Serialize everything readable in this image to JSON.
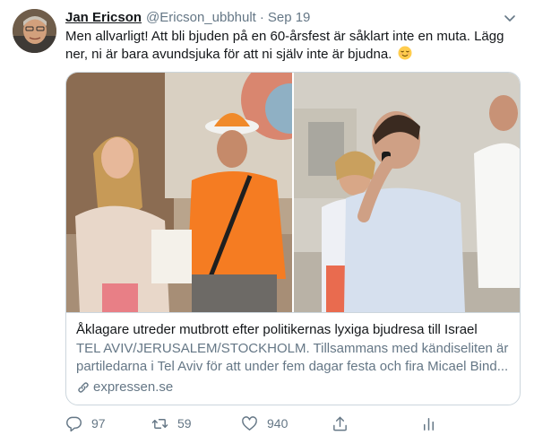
{
  "tweet": {
    "author_name": "Jan Ericson",
    "author_handle": "@Ericson_ubbhult",
    "separator": "·",
    "timestamp": "Sep 19",
    "text": "Men allvarligt! Att bli bjuden på en 60-årsfest är såklart inte en muta. Lägg ner, ni är bara avundsjuka för att ni själv inte är bjudna.",
    "emoji_icon": "relieved-face-emoji"
  },
  "card": {
    "title": "Åklagare utreder mutbrott efter politikernas lyxiga bjudresa till Israel",
    "description": "TEL AVIV/JERUSALEM/STOCKHOLM. Tillsammans med kändiseliten är partiledarna i Tel Aviv för att under fem dagar festa och fira Micael Bind...",
    "domain": "expressen.se",
    "image_icon": "news-photo"
  },
  "actions": {
    "reply_count": "97",
    "retweet_count": "59",
    "like_count": "940"
  },
  "colors": {
    "text": "#14171a",
    "secondary": "#657786",
    "border": "#ccd6dd"
  }
}
